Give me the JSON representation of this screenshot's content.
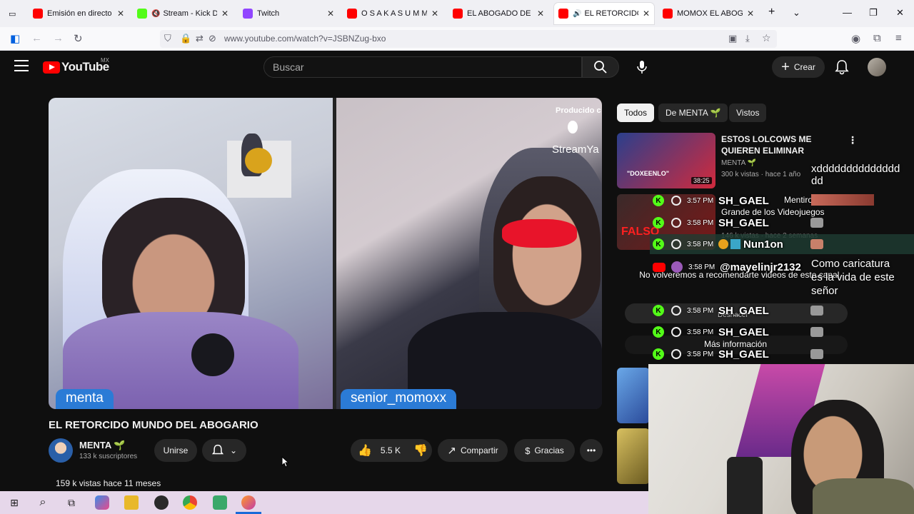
{
  "browser": {
    "tabs": [
      {
        "label": "Emisión en directo - Yo",
        "color": "#ff0000"
      },
      {
        "label": "Stream - Kick Dash",
        "color": "#53fc18"
      },
      {
        "label": "Twitch",
        "color": "#9146ff"
      },
      {
        "label": "O S A K A   S U M M E",
        "color": "#ff0000"
      },
      {
        "label": "EL ABOGADO DE ESPA",
        "color": "#ff0000"
      },
      {
        "label": "EL RETORCIDO MU",
        "color": "#ff0000"
      },
      {
        "label": "MOMOX EL ABOGADO",
        "color": "#ff0000"
      }
    ],
    "url": "www.youtube.com/watch?v=JSBNZug-bxo"
  },
  "youtube": {
    "logo_text": "YouTube",
    "region": "MX",
    "search_placeholder": "Buscar",
    "create_label": "Crear"
  },
  "player": {
    "left_name": "menta",
    "right_name": "senior_momoxx",
    "produced_by": "Producido c",
    "brand": "StreamYa"
  },
  "video": {
    "title": "EL RETORCIDO MUNDO DEL ABOGARIO",
    "channel": "MENTA 🌱",
    "subscribers": "133 k suscriptores",
    "join_label": "Unirse",
    "likes": "5.5 K",
    "share_label": "Compartir",
    "thanks_label": "Gracias",
    "views_line": "159 k vistas  hace 11 meses"
  },
  "sidebar": {
    "chips": [
      "Todos",
      "De MENTA 🌱",
      "Vistos"
    ],
    "recs": [
      {
        "title": "ESTOS LOLCOWS ME QUIEREN ELIMINAR",
        "channel": "MENTA 🌱",
        "meta": "300 k vistas · hace 1 año",
        "duration": "38:25",
        "thumb_text": "\"DOXEENLO\""
      },
      {
        "title_partial": "Grande de los Videojuegos",
        "meta": "146 k vistas · hace 2 semanas",
        "prefix": "Mentiroso m",
        "thumb_text": "FALSO"
      }
    ],
    "not_recommend": "No volveremos a recomendarte videos de este canal.",
    "undo": "Deshacer",
    "more_info": "Más información"
  },
  "chat": {
    "messages": [
      {
        "time": "3:57 PM",
        "user": "SH_GAEL",
        "badge": "kick"
      },
      {
        "time": "3:58 PM",
        "user": "SH_GAEL",
        "badge": "kick"
      },
      {
        "time": "3:58 PM",
        "user": "Nun1on",
        "badge": "kick"
      },
      {
        "time": "3:58 PM",
        "user": "@mayelinjr2132",
        "badge": "youtube"
      },
      {
        "time": "3:58 PM",
        "user": "SH_GAEL",
        "badge": "kick"
      },
      {
        "time": "3:58 PM",
        "user": "SH_GAEL",
        "badge": "kick"
      },
      {
        "time": "3:58 PM",
        "user": "SH_GAEL",
        "badge": "kick"
      }
    ],
    "side_msg_1": "xdddddddddddddd",
    "side_msg_1b": "dd",
    "side_msg_2a": "Como caricatura",
    "side_msg_2b": "es la vida de este",
    "side_msg_2c": "señor"
  },
  "colors": {
    "kick": "#53fc18",
    "yt_red": "#ff0000",
    "nameplate": "#2b7bd6"
  }
}
